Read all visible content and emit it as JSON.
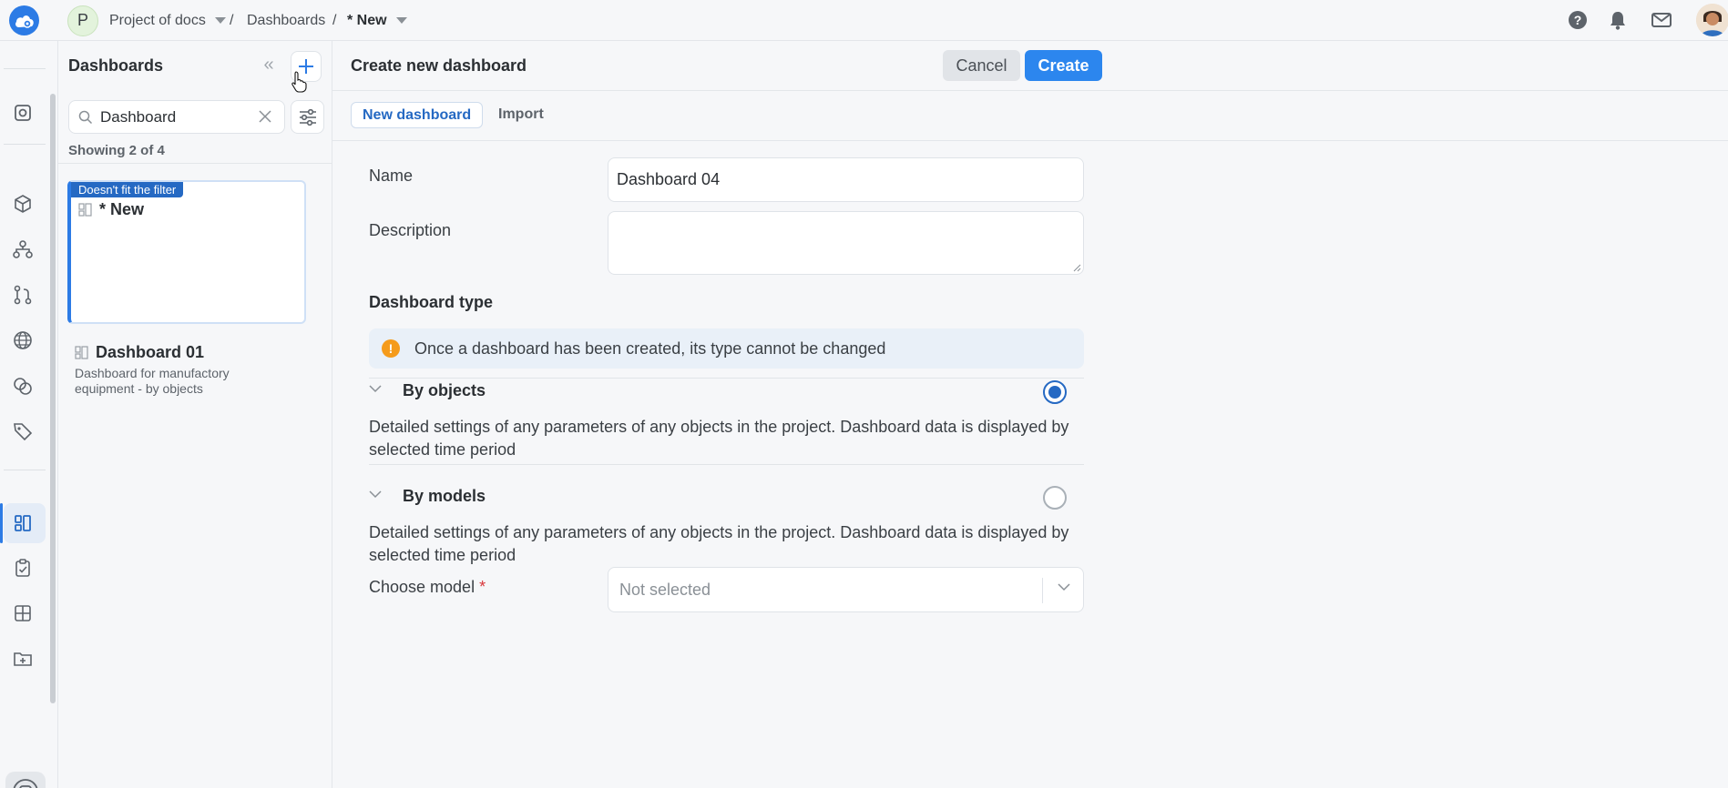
{
  "topbar": {
    "project_initial": "P",
    "project_name": "Project of docs",
    "separator": "/",
    "crumb_dashboards": "Dashboards",
    "crumb_current": "* New",
    "icons": [
      "help-icon",
      "bell-icon",
      "mail-icon"
    ]
  },
  "rail": {
    "icons": [
      "objects-icon",
      "cube-icon",
      "hierarchy-icon",
      "branch-icon",
      "globe-icon",
      "shapes-icon",
      "tag-icon",
      "dashboards-icon",
      "tasks-icon",
      "table-icon",
      "folder-add-icon"
    ],
    "active": "dashboards-icon"
  },
  "panel": {
    "title": "Dashboards",
    "search_value": "Dashboard",
    "showing": "Showing 2 of 4",
    "cards": [
      {
        "badge": "Doesn't fit the filter",
        "title": "* New",
        "description": ""
      },
      {
        "badge": "",
        "title": "Dashboard 01",
        "description": "Dashboard for manufactory equipment - by objects"
      }
    ]
  },
  "main": {
    "title": "Create new dashboard",
    "cancel_label": "Cancel",
    "create_label": "Create",
    "tabs": [
      {
        "label": "New dashboard",
        "active": true
      },
      {
        "label": "Import",
        "active": false
      }
    ],
    "form": {
      "name_label": "Name",
      "name_value": "Dashboard 04",
      "description_label": "Description",
      "description_value": "",
      "type_title": "Dashboard type",
      "notice": "Once a dashboard has been created, its type cannot be changed",
      "options": [
        {
          "title": "By objects",
          "selected": true,
          "description": "Detailed settings of any parameters of any objects in the project. Dashboard data is displayed by selected time period"
        },
        {
          "title": "By models",
          "selected": false,
          "description": "Detailed settings of any parameters of any objects in the project. Dashboard data is displayed by selected time period"
        }
      ],
      "model_label": "Choose model",
      "model_required_mark": "*",
      "model_placeholder": "Not selected"
    }
  },
  "colors": {
    "accent": "#2c7be5",
    "create_button": "#2c86ee",
    "badge": "#2569c3",
    "warning": "#f59b1b",
    "required": "#d8363a"
  }
}
